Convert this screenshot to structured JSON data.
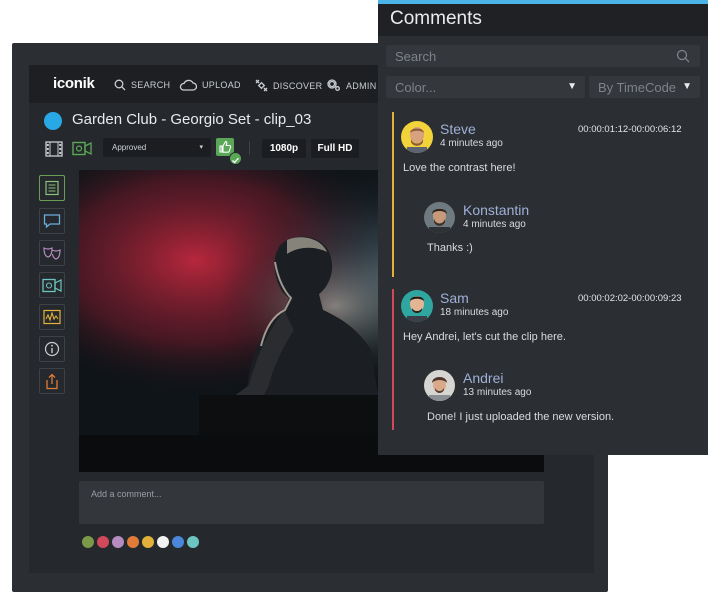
{
  "app": {
    "brand": "iconik",
    "nav": [
      {
        "label": "SEARCH",
        "icon": "search-icon"
      },
      {
        "label": "UPLOAD",
        "icon": "cloud-upload-icon"
      },
      {
        "label": "DISCOVER",
        "icon": "satellite-icon"
      },
      {
        "label": "ADMIN",
        "icon": "gears-icon"
      }
    ]
  },
  "asset": {
    "title": "Garden Club - Georgio Set - clip_03",
    "title_dot_color": "#29a8e6",
    "status": "Approved",
    "resolution": "1080p",
    "quality": "Full HD"
  },
  "comment_input": {
    "placeholder": "Add a comment..."
  },
  "swatches": [
    "#7a9a4a",
    "#d1495b",
    "#b48cc0",
    "#e07b3a",
    "#e0b23a",
    "#f2f2f2",
    "#4a86d9",
    "#6cc5c0"
  ],
  "comments_panel": {
    "title": "Comments",
    "search_placeholder": "Search",
    "color_filter": "Color...",
    "sort": "By TimeCode",
    "threads": [
      {
        "author": "Steve",
        "time": "4 minutes ago",
        "timecode": "00:00:01:12-00:00:06:12",
        "text": "Love the contrast here!",
        "color": "#e0b23a",
        "reply": {
          "author": "Konstantin",
          "time": "4 minutes ago",
          "text": "Thanks :)"
        }
      },
      {
        "author": "Sam",
        "time": "18 minutes ago",
        "timecode": "00:00:02:02-00:00:09:23",
        "text": "Hey Andrei, let's cut the clip here.",
        "color": "#d1495b",
        "reply": {
          "author": "Andrei",
          "time": "13 minutes ago",
          "text": "Done! I just uploaded the new version."
        }
      }
    ]
  }
}
